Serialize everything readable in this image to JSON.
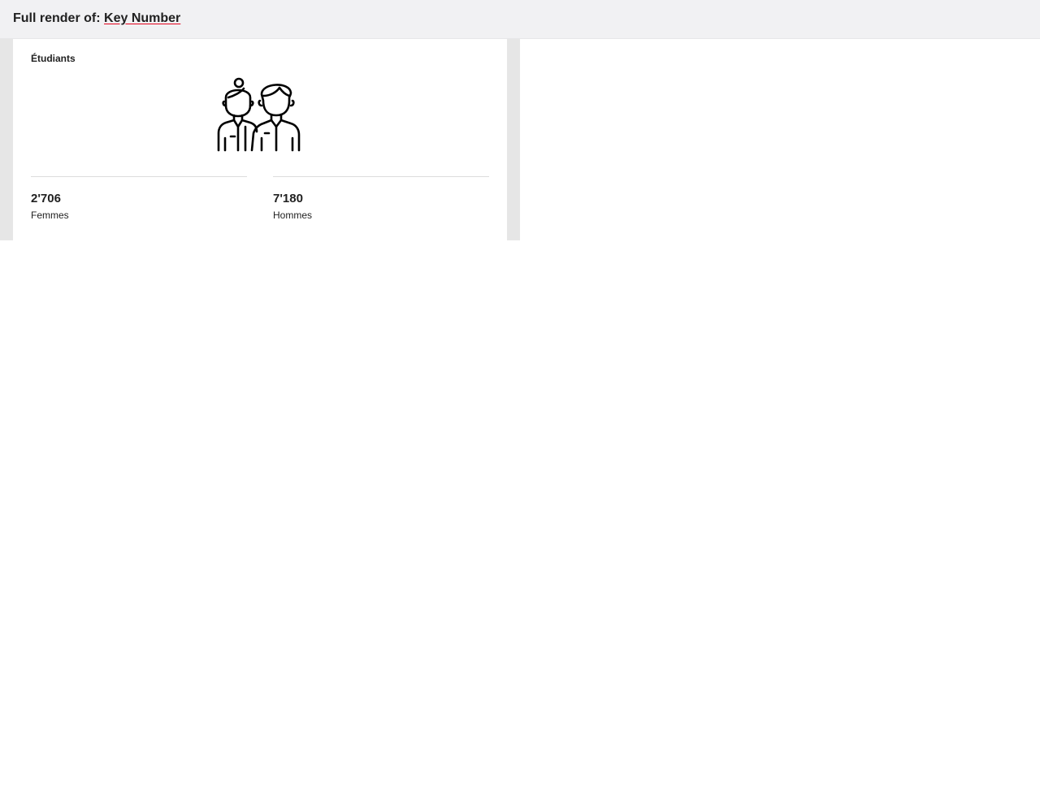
{
  "header": {
    "prefix": "Full render of:",
    "link_label": "Key Number"
  },
  "card": {
    "title": "Étudiants",
    "icon": "students-couple-icon",
    "stats": [
      {
        "value": "2'706",
        "label": "Femmes"
      },
      {
        "value": "7'180",
        "label": "Hommes"
      }
    ]
  },
  "colors": {
    "header_bg": "#f1f1f3",
    "stage_bg": "#e6e6e6",
    "link_underline": "#e2001a",
    "text": "#212121",
    "divider": "#dddddd"
  }
}
